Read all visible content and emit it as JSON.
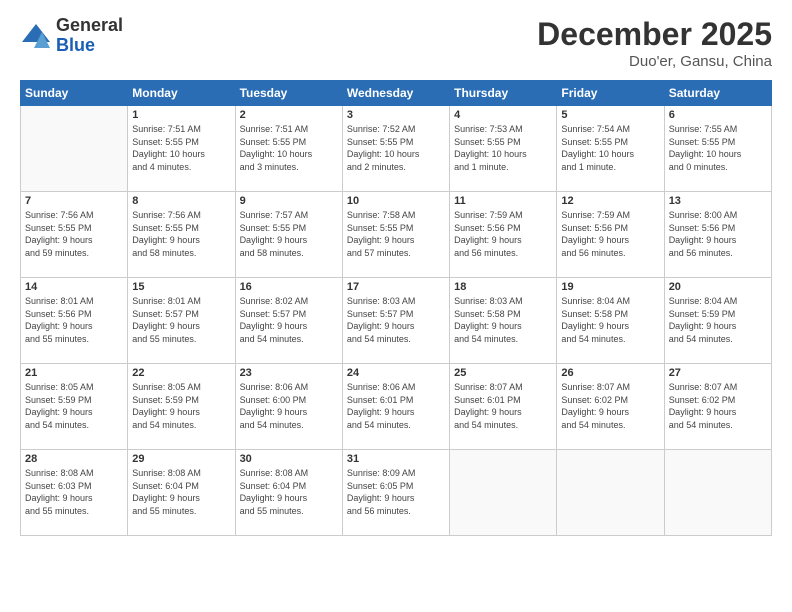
{
  "logo": {
    "general": "General",
    "blue": "Blue"
  },
  "title": "December 2025",
  "location": "Duo'er, Gansu, China",
  "weekdays": [
    "Sunday",
    "Monday",
    "Tuesday",
    "Wednesday",
    "Thursday",
    "Friday",
    "Saturday"
  ],
  "weeks": [
    [
      {
        "day": "",
        "info": ""
      },
      {
        "day": "1",
        "info": "Sunrise: 7:51 AM\nSunset: 5:55 PM\nDaylight: 10 hours\nand 4 minutes."
      },
      {
        "day": "2",
        "info": "Sunrise: 7:51 AM\nSunset: 5:55 PM\nDaylight: 10 hours\nand 3 minutes."
      },
      {
        "day": "3",
        "info": "Sunrise: 7:52 AM\nSunset: 5:55 PM\nDaylight: 10 hours\nand 2 minutes."
      },
      {
        "day": "4",
        "info": "Sunrise: 7:53 AM\nSunset: 5:55 PM\nDaylight: 10 hours\nand 1 minute."
      },
      {
        "day": "5",
        "info": "Sunrise: 7:54 AM\nSunset: 5:55 PM\nDaylight: 10 hours\nand 1 minute."
      },
      {
        "day": "6",
        "info": "Sunrise: 7:55 AM\nSunset: 5:55 PM\nDaylight: 10 hours\nand 0 minutes."
      }
    ],
    [
      {
        "day": "7",
        "info": "Sunrise: 7:56 AM\nSunset: 5:55 PM\nDaylight: 9 hours\nand 59 minutes."
      },
      {
        "day": "8",
        "info": "Sunrise: 7:56 AM\nSunset: 5:55 PM\nDaylight: 9 hours\nand 58 minutes."
      },
      {
        "day": "9",
        "info": "Sunrise: 7:57 AM\nSunset: 5:55 PM\nDaylight: 9 hours\nand 58 minutes."
      },
      {
        "day": "10",
        "info": "Sunrise: 7:58 AM\nSunset: 5:55 PM\nDaylight: 9 hours\nand 57 minutes."
      },
      {
        "day": "11",
        "info": "Sunrise: 7:59 AM\nSunset: 5:56 PM\nDaylight: 9 hours\nand 56 minutes."
      },
      {
        "day": "12",
        "info": "Sunrise: 7:59 AM\nSunset: 5:56 PM\nDaylight: 9 hours\nand 56 minutes."
      },
      {
        "day": "13",
        "info": "Sunrise: 8:00 AM\nSunset: 5:56 PM\nDaylight: 9 hours\nand 56 minutes."
      }
    ],
    [
      {
        "day": "14",
        "info": "Sunrise: 8:01 AM\nSunset: 5:56 PM\nDaylight: 9 hours\nand 55 minutes."
      },
      {
        "day": "15",
        "info": "Sunrise: 8:01 AM\nSunset: 5:57 PM\nDaylight: 9 hours\nand 55 minutes."
      },
      {
        "day": "16",
        "info": "Sunrise: 8:02 AM\nSunset: 5:57 PM\nDaylight: 9 hours\nand 54 minutes."
      },
      {
        "day": "17",
        "info": "Sunrise: 8:03 AM\nSunset: 5:57 PM\nDaylight: 9 hours\nand 54 minutes."
      },
      {
        "day": "18",
        "info": "Sunrise: 8:03 AM\nSunset: 5:58 PM\nDaylight: 9 hours\nand 54 minutes."
      },
      {
        "day": "19",
        "info": "Sunrise: 8:04 AM\nSunset: 5:58 PM\nDaylight: 9 hours\nand 54 minutes."
      },
      {
        "day": "20",
        "info": "Sunrise: 8:04 AM\nSunset: 5:59 PM\nDaylight: 9 hours\nand 54 minutes."
      }
    ],
    [
      {
        "day": "21",
        "info": "Sunrise: 8:05 AM\nSunset: 5:59 PM\nDaylight: 9 hours\nand 54 minutes."
      },
      {
        "day": "22",
        "info": "Sunrise: 8:05 AM\nSunset: 5:59 PM\nDaylight: 9 hours\nand 54 minutes."
      },
      {
        "day": "23",
        "info": "Sunrise: 8:06 AM\nSunset: 6:00 PM\nDaylight: 9 hours\nand 54 minutes."
      },
      {
        "day": "24",
        "info": "Sunrise: 8:06 AM\nSunset: 6:01 PM\nDaylight: 9 hours\nand 54 minutes."
      },
      {
        "day": "25",
        "info": "Sunrise: 8:07 AM\nSunset: 6:01 PM\nDaylight: 9 hours\nand 54 minutes."
      },
      {
        "day": "26",
        "info": "Sunrise: 8:07 AM\nSunset: 6:02 PM\nDaylight: 9 hours\nand 54 minutes."
      },
      {
        "day": "27",
        "info": "Sunrise: 8:07 AM\nSunset: 6:02 PM\nDaylight: 9 hours\nand 54 minutes."
      }
    ],
    [
      {
        "day": "28",
        "info": "Sunrise: 8:08 AM\nSunset: 6:03 PM\nDaylight: 9 hours\nand 55 minutes."
      },
      {
        "day": "29",
        "info": "Sunrise: 8:08 AM\nSunset: 6:04 PM\nDaylight: 9 hours\nand 55 minutes."
      },
      {
        "day": "30",
        "info": "Sunrise: 8:08 AM\nSunset: 6:04 PM\nDaylight: 9 hours\nand 55 minutes."
      },
      {
        "day": "31",
        "info": "Sunrise: 8:09 AM\nSunset: 6:05 PM\nDaylight: 9 hours\nand 56 minutes."
      },
      {
        "day": "",
        "info": ""
      },
      {
        "day": "",
        "info": ""
      },
      {
        "day": "",
        "info": ""
      }
    ]
  ]
}
